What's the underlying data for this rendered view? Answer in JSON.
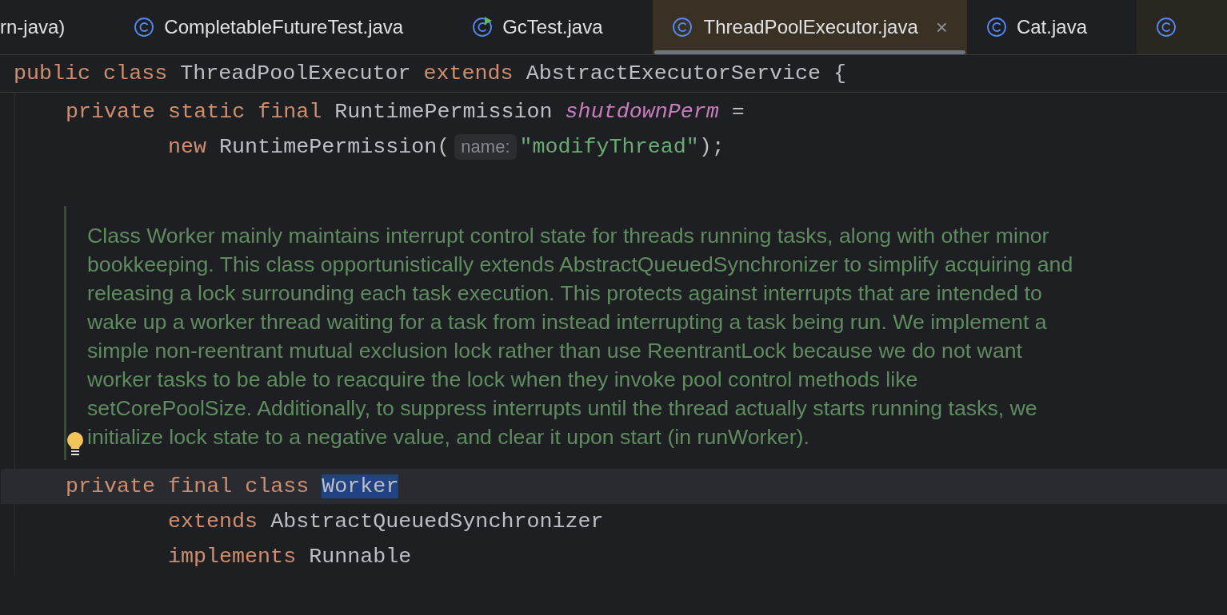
{
  "tabs": [
    {
      "label": "rn-java)",
      "selected": false
    },
    {
      "kind": "class",
      "label": "CompletableFutureTest.java",
      "selected": false
    },
    {
      "kind": "runnable-class",
      "label": "GcTest.java",
      "selected": false
    },
    {
      "kind": "class",
      "label": "ThreadPoolExecutor.java",
      "selected": true,
      "close": "×"
    },
    {
      "kind": "class",
      "label": "Cat.java",
      "selected": false
    },
    {
      "kind": "class",
      "selected": false
    }
  ],
  "sticky_line": {
    "tokens": [
      {
        "kind": "keyword",
        "text": "public class "
      },
      {
        "kind": "plain",
        "text": "ThreadPoolExecutor "
      },
      {
        "kind": "keyword",
        "text": "extends "
      },
      {
        "kind": "plain",
        "text": "AbstractExecutorService {"
      }
    ]
  },
  "lines": [
    {
      "kind": "member",
      "current": false,
      "tokens": [
        {
          "kind": "keyword",
          "text": "private static final "
        },
        {
          "kind": "plain",
          "text": "RuntimePermission "
        },
        {
          "kind": "field",
          "text": "shutdownPerm"
        },
        {
          "kind": "plain",
          "text": " ="
        }
      ]
    },
    {
      "kind": "continuation",
      "current": false,
      "tokens": [
        {
          "kind": "keyword",
          "text": "new "
        },
        {
          "kind": "plain",
          "text": "RuntimePermission("
        },
        {
          "kind": "hint",
          "text": "name:"
        },
        {
          "kind": "string",
          "text": "\"modifyThread\""
        },
        {
          "kind": "plain",
          "text": ");"
        }
      ]
    },
    {
      "kind": "blank"
    },
    {
      "kind": "doc",
      "bulb": true,
      "text": "Class Worker mainly maintains interrupt control state for threads running tasks, along with other minor bookkeeping. This class opportunistically extends AbstractQueuedSynchronizer to simplify acquiring and releasing a lock surrounding each task execution. This protects against interrupts that are intended to wake up a worker thread waiting for a task from instead interrupting a task being run. We implement a simple non-reentrant mutual exclusion lock rather than use ReentrantLock because we do not want worker tasks to be able to reacquire the lock when they invoke pool control methods like setCorePoolSize. Additionally, to suppress interrupts until the thread actually starts running tasks, we initialize lock state to a negative value, and clear it upon start (in runWorker)."
    },
    {
      "kind": "member",
      "current": true,
      "tokens": [
        {
          "kind": "keyword",
          "text": "private final class "
        },
        {
          "kind": "selection",
          "text": "Worker"
        }
      ]
    },
    {
      "kind": "continuation",
      "current": false,
      "tokens": [
        {
          "kind": "keyword",
          "text": "extends "
        },
        {
          "kind": "plain",
          "text": "AbstractQueuedSynchronizer"
        }
      ]
    },
    {
      "kind": "continuation",
      "current": false,
      "tokens": [
        {
          "kind": "keyword",
          "text": "implements "
        },
        {
          "kind": "plain",
          "text": "Runnable"
        }
      ]
    }
  ]
}
